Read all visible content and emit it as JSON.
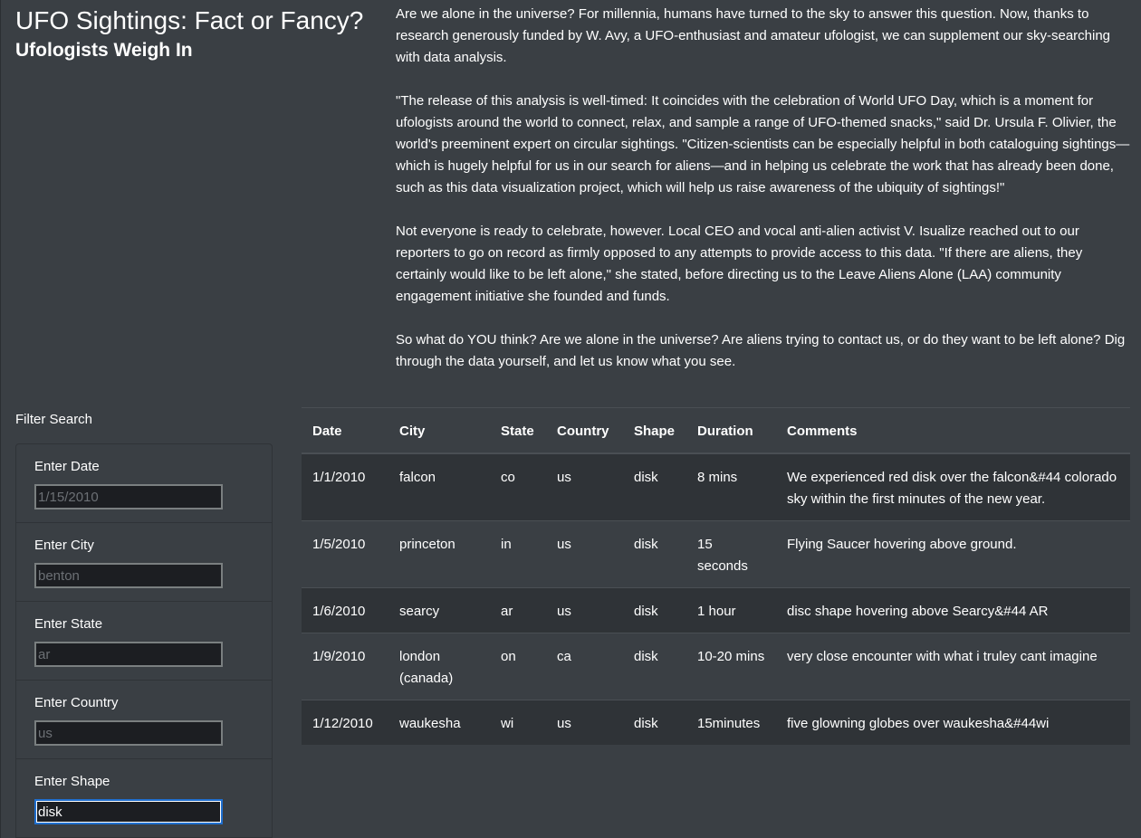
{
  "header": {
    "title": "UFO Sightings: Fact or Fancy?",
    "subtitle": "Ufologists Weigh In"
  },
  "article": {
    "paragraphs": [
      "Are we alone in the universe? For millennia, humans have turned to the sky to answer this question. Now, thanks to research generously funded by W. Avy, a UFO-enthusiast and amateur ufologist, we can supplement our sky-searching with data analysis.",
      "\"The release of this analysis is well-timed: It coincides with the celebration of World UFO Day, which is a moment for ufologists around the world to connect, relax, and sample a range of UFO-themed snacks,\" said Dr. Ursula F. Olivier, the world's preeminent expert on circular sightings. \"Citizen-scientists can be especially helpful in both cataloguing sightings—which is hugely helpful for us in our search for aliens—and in helping us celebrate the work that has already been done, such as this data visualization project, which will help us raise awareness of the ubiquity of sightings!\"",
      "Not everyone is ready to celebrate, however. Local CEO and vocal anti-alien activist V. Isualize reached out to our reporters to go on record as firmly opposed to any attempts to provide access to this data. \"If there are aliens, they certainly would like to be left alone,\" she stated, before directing us to the Leave Aliens Alone (LAA) community engagement initiative she founded and funds.",
      "So what do YOU think? Are we alone in the universe? Are aliens trying to contact us, or do they want to be left alone? Dig through the data yourself, and let us know what you see."
    ]
  },
  "filters": {
    "title": "Filter Search",
    "date": {
      "label": "Enter Date",
      "placeholder": "1/15/2010",
      "value": ""
    },
    "city": {
      "label": "Enter City",
      "placeholder": "benton",
      "value": ""
    },
    "state": {
      "label": "Enter State",
      "placeholder": "ar",
      "value": ""
    },
    "country": {
      "label": "Enter Country",
      "placeholder": "us",
      "value": ""
    },
    "shape": {
      "label": "Enter Shape",
      "placeholder": "",
      "value": "disk"
    }
  },
  "table": {
    "headers": {
      "date": "Date",
      "city": "City",
      "state": "State",
      "country": "Country",
      "shape": "Shape",
      "duration": "Duration",
      "comments": "Comments"
    },
    "rows": [
      {
        "date": "1/1/2010",
        "city": "falcon",
        "state": "co",
        "country": "us",
        "shape": "disk",
        "duration": "8 mins",
        "comments": "We experienced red disk over the falcon&#44 colorado sky within the first minutes of the new year."
      },
      {
        "date": "1/5/2010",
        "city": "princeton",
        "state": "in",
        "country": "us",
        "shape": "disk",
        "duration": "15 seconds",
        "comments": "Flying Saucer hovering above ground."
      },
      {
        "date": "1/6/2010",
        "city": "searcy",
        "state": "ar",
        "country": "us",
        "shape": "disk",
        "duration": "1 hour",
        "comments": "disc shape hovering above Searcy&#44 AR"
      },
      {
        "date": "1/9/2010",
        "city": "london (canada)",
        "state": "on",
        "country": "ca",
        "shape": "disk",
        "duration": "10-20 mins",
        "comments": "very close encounter with what i truley cant imagine"
      },
      {
        "date": "1/12/2010",
        "city": "waukesha",
        "state": "wi",
        "country": "us",
        "shape": "disk",
        "duration": "15minutes",
        "comments": "five glowning globes over waukesha&#44wi"
      }
    ]
  }
}
